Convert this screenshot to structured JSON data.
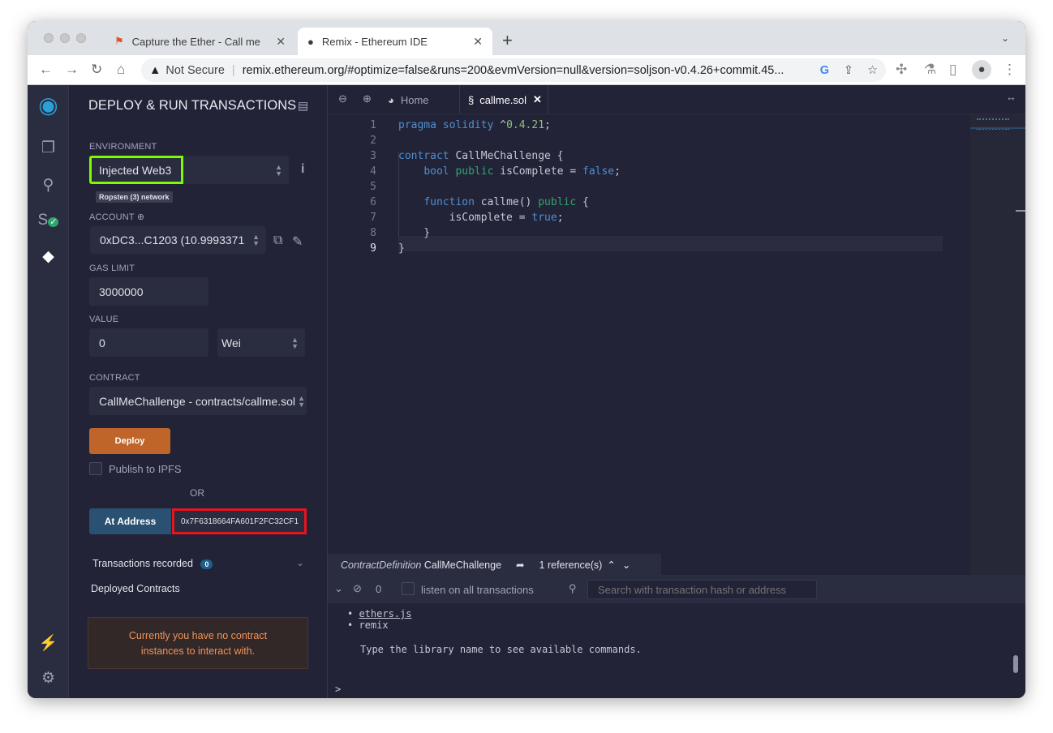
{
  "browser": {
    "tabs": [
      {
        "label": "Capture the Ether - Call me",
        "icon": "flag-icon"
      },
      {
        "label": "Remix - Ethereum IDE",
        "icon": "remix-icon"
      }
    ],
    "security_label": "Not Secure",
    "url": "remix.ethereum.org/#optimize=false&runs=200&evmVersion=null&version=soljson-v0.4.26+commit.45..."
  },
  "panel": {
    "title": "DEPLOY & RUN TRANSACTIONS",
    "environment_label": "ENVIRONMENT",
    "environment_value": "Injected Web3",
    "network_badge": "Ropsten (3) network",
    "account_label": "ACCOUNT",
    "account_value": "0xDC3...C1203 (10.9993371",
    "gas_limit_label": "GAS LIMIT",
    "gas_limit_value": "3000000",
    "value_label": "VALUE",
    "value_value": "0",
    "value_unit": "Wei",
    "contract_label": "CONTRACT",
    "contract_value": "CallMeChallenge - contracts/callme.sol",
    "deploy_label": "Deploy",
    "publish_label": "Publish to IPFS",
    "or_label": "OR",
    "at_address_label": "At Address",
    "at_address_value": "0x7F6318664FA601F2FC32CF1",
    "transactions_label": "Transactions recorded",
    "transactions_count": "0",
    "deployed_label": "Deployed Contracts",
    "no_instances_line1": "Currently you have no contract",
    "no_instances_line2": "instances to interact with."
  },
  "editor": {
    "tabs": [
      {
        "label": "Home"
      },
      {
        "label": "callme.sol"
      }
    ],
    "lines": [
      [
        {
          "t": "pragma solidity",
          "c": "kw"
        },
        {
          "t": " ^",
          "c": ""
        },
        {
          "t": "0.4.21",
          "c": "num"
        },
        {
          "t": ";",
          "c": ""
        }
      ],
      [],
      [
        {
          "t": "contract",
          "c": "kw"
        },
        {
          "t": " CallMeChallenge {",
          "c": ""
        }
      ],
      [
        {
          "t": "    ",
          "c": ""
        },
        {
          "t": "bool",
          "c": "kw"
        },
        {
          "t": " ",
          "c": ""
        },
        {
          "t": "public",
          "c": "md"
        },
        {
          "t": " isComplete = ",
          "c": ""
        },
        {
          "t": "false",
          "c": "kw"
        },
        {
          "t": ";",
          "c": ""
        }
      ],
      [],
      [
        {
          "t": "    ",
          "c": ""
        },
        {
          "t": "function",
          "c": "kw"
        },
        {
          "t": " callme() ",
          "c": ""
        },
        {
          "t": "public",
          "c": "md"
        },
        {
          "t": " {",
          "c": ""
        }
      ],
      [
        {
          "t": "        isComplete = ",
          "c": ""
        },
        {
          "t": "true",
          "c": "kw"
        },
        {
          "t": ";",
          "c": ""
        }
      ],
      [
        {
          "t": "    }",
          "c": ""
        }
      ],
      [
        {
          "t": "}",
          "c": ""
        }
      ]
    ],
    "ref_kind": "ContractDefinition",
    "ref_name": "CallMeChallenge",
    "ref_count": "1 reference(s)"
  },
  "terminal": {
    "pending_count": "0",
    "listen_label": "listen on all transactions",
    "search_placeholder": "Search with transaction hash or address",
    "libs": [
      "ethers.js",
      "remix"
    ],
    "hint": "Type the library name to see available commands.",
    "prompt": ">"
  }
}
